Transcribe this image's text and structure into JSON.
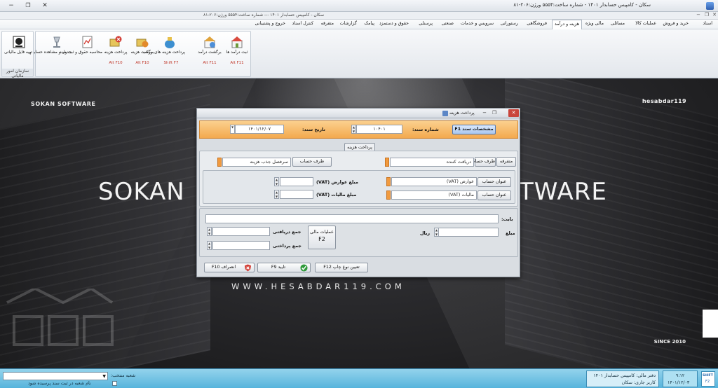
{
  "window": {
    "title": "سکان - کامپیس حسابدار ۱۴۰۱ - شماره ساخت:۵۵۵۴  ورژن:۲۰۶-۸۱",
    "inner_title": "سکان - کامپیس حسابدار ۱۴۰۱ --- شماره ساخت:۵۵۵۴   ورژن:۲۰۶-۸۱",
    "minimize": "−",
    "maximize": "❐",
    "close": "✕"
  },
  "menu": {
    "items": [
      "اسناد",
      "خرید و فروش",
      "عملیات کالا",
      "مسائلی",
      "مالی ویژه",
      "هزینه و درآمد",
      "فروشگاهی",
      "رستورانی",
      "سرویس و خدمات",
      "صنعتی",
      "پرسنلی",
      "حقوق و دستمزد",
      "پیامک",
      "گزارشات",
      "متفرقه",
      "کنترل اسناد",
      "خروج و پشتیبانی"
    ],
    "active": "هزینه و درآمد"
  },
  "ribbon": {
    "group1": {
      "buttons": [
        {
          "label": "ثبت درآمد ها",
          "key": "Alt F11",
          "icon": "house-document-icon"
        },
        {
          "label": "برگشت درآمد",
          "key": "Alt F11",
          "icon": "house-return-icon"
        },
        {
          "label": "پرداخت هزینه های مرکب",
          "key": "Shift F7",
          "icon": "money-bag-icon"
        },
        {
          "label": "برگشت هزینه",
          "key": "Alt F10",
          "icon": "money-return-icon"
        },
        {
          "label": "پرداخت هزینه",
          "key": "Alt F10",
          "icon": "money-cancel-icon"
        },
        {
          "label": "محاسبه حقوق و ثبت سند",
          "key": "",
          "icon": "chart-calc-icon"
        },
        {
          "label": "جدول و مشاهده حسابها",
          "key": "",
          "icon": "lamp-table-icon"
        }
      ]
    },
    "group2": {
      "button": {
        "label": "تهیه فایل مالیاتی",
        "icon": "tax-org-logo-icon"
      },
      "group_label": "سازمان امور مالیاتی"
    }
  },
  "workspace": {
    "sokan_software": "SOKAN SOFTWARE",
    "hesabdar": "hesabdar119",
    "big_left": "SOKAN",
    "big_right": "TWARE",
    "www": "WWW.HESABDAR119.COM",
    "since": "SINCE 2010"
  },
  "dialog": {
    "title": "پرداخت هزینه",
    "doc_spec_button": "مشخصات سند F1",
    "doc_number_label": "شماره سند:",
    "doc_number": "۱۰۴۰۱",
    "doc_date_label": "تاریخ سند:",
    "doc_date": "۱۴۰۱/۱۲/۰۷",
    "section_label": "پرداخت هزینه",
    "misc_button": "متفرقه",
    "account_side_button": "طرف حساب",
    "receiver_placeholder": "دریافت کننده",
    "other_side_button": "طرف حساب",
    "cost_heading_placeholder": "سرفصل جذب هزینه",
    "account_title_button_1": "عنوان حساب",
    "account_title_field_1": "عوارض (VAT)",
    "account_title_button_2": "عنوان حساب",
    "account_title_field_2": "مالیات (VAT)",
    "vat_toll_amount_label": "مبلغ عوارض (VAT)",
    "vat_tax_amount_label": "مبلغ مالیات (VAT)",
    "for_label": "بابت:",
    "amount_label": "مبلغ",
    "rial_label": "ریال",
    "financial_ops_button": "عملیات مالی",
    "financial_ops_key": "F2",
    "total_received_label": "جمع دریافتی",
    "total_paid_label": "جمع پرداختی",
    "print_type_button": "تعیین نوع چاپ F12",
    "confirm_button": "تایید F9",
    "cancel_button": "انصراف F10"
  },
  "statusbar": {
    "branch_label": "شعبه منتخب:",
    "branch_checkbox_label": "نام شعبه در ثبت سند پرسیده شود",
    "fiscal_office": "دفتر مالی: کامپیس حسابدار ۱۴۰۱",
    "current_user": "کاربر جاری: سکان",
    "time": "۹:۱۲",
    "date": "۱۴۰۱/۱۲/۰۳",
    "shift_indicator": "SHIFT",
    "key_indicator": "F2"
  },
  "colors": {
    "orange_accent": "#f3a94e",
    "status_blue": "#57b4dc",
    "close_red": "#c9453b"
  }
}
